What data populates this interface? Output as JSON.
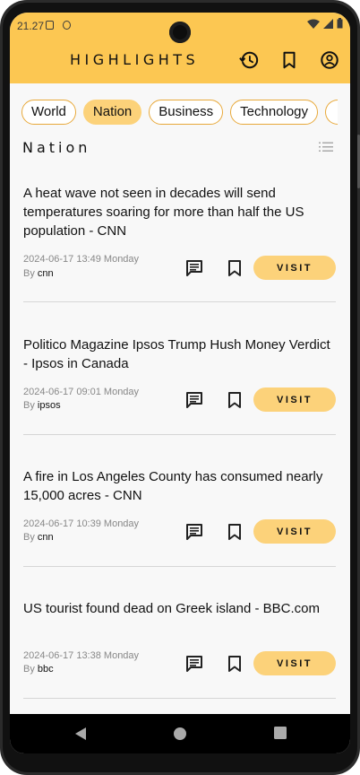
{
  "status": {
    "time": "21.27"
  },
  "header": {
    "title": "HIGHLIGHTS"
  },
  "icons": {
    "history": "history-icon",
    "bookmarks": "bookmark-icon",
    "account": "account-icon",
    "comment": "comment-icon",
    "list": "list-view-icon"
  },
  "colors": {
    "accent": "#fcc752",
    "chip_active": "#fcd27a",
    "chip_border": "#e8a93a"
  },
  "categories": [
    "World",
    "Nation",
    "Business",
    "Technology"
  ],
  "active_category": "Nation",
  "section": {
    "title": "Nation"
  },
  "articles": [
    {
      "title": "A heat wave not seen in decades will send temperatures soaring for more than half the US population - CNN",
      "date": "2024-06-17 13:49 Monday",
      "by_label": "By",
      "source": "cnn",
      "visit_label": "VISIT"
    },
    {
      "title": "Politico Magazine Ipsos Trump Hush Money Verdict - Ipsos in Canada",
      "date": "2024-06-17 09:01 Monday",
      "by_label": "By",
      "source": "ipsos",
      "visit_label": "VISIT"
    },
    {
      "title": "A fire in Los Angeles County has consumed nearly 15,000 acres - CNN",
      "date": "2024-06-17 10:39 Monday",
      "by_label": "By",
      "source": "cnn",
      "visit_label": "VISIT"
    },
    {
      "title": "US tourist found dead on Greek island - BBC.com",
      "date": "2024-06-17 13:38 Monday",
      "by_label": "By",
      "source": "bbc",
      "visit_label": "VISIT"
    }
  ]
}
